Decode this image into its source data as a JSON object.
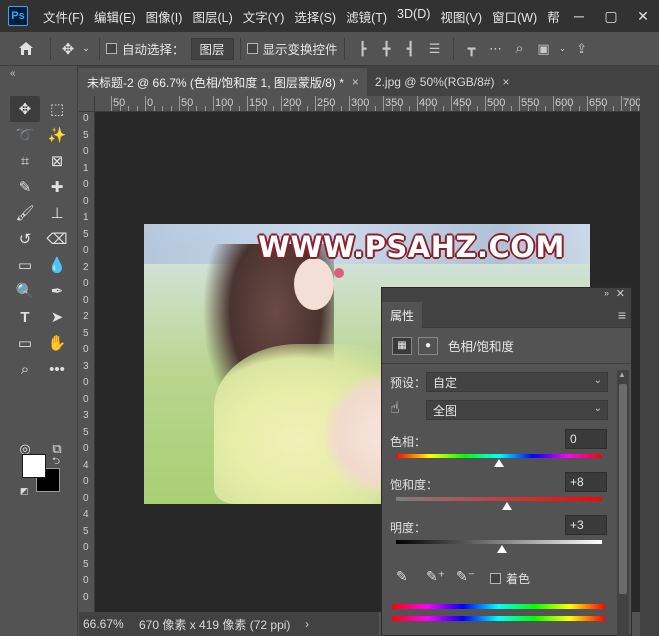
{
  "app": {
    "logo": "Ps"
  },
  "menus": [
    "文件(F)",
    "编辑(E)",
    "图像(I)",
    "图层(L)",
    "文字(Y)",
    "选择(S)",
    "滤镜(T)",
    "3D(D)",
    "视图(V)",
    "窗口(W)",
    "帮"
  ],
  "window_controls": {
    "minimize": "─",
    "maximize": "▢",
    "close": "✕"
  },
  "options": {
    "auto_select_label": "自动选择：",
    "auto_select_value": "图层",
    "show_transform_label": "显示变换控件"
  },
  "tabs": [
    {
      "label": "未标题-2 @ 66.7% (色相/饱和度 1, 图层蒙版/8) *",
      "close": "×"
    },
    {
      "label": "2.jpg @ 50%(RGB/8#)",
      "close": "×"
    }
  ],
  "ruler_top": [
    "50",
    "0",
    "50",
    "100",
    "150",
    "200",
    "250",
    "300",
    "350",
    "400",
    "450",
    "500",
    "550",
    "600",
    "650",
    "700"
  ],
  "ruler_left": [
    "0",
    "5",
    "0",
    "1",
    "0",
    "0",
    "1",
    "5",
    "0",
    "2",
    "0",
    "0",
    "2",
    "5",
    "0",
    "3",
    "0",
    "0",
    "3",
    "5",
    "0",
    "4",
    "0",
    "0",
    "4",
    "5",
    "0",
    "5",
    "0",
    "0"
  ],
  "image": {
    "watermark": "WWW.PSAHZ.COM"
  },
  "status": {
    "zoom": "66.67%",
    "doc_info": "670 像素 x 419 像素 (72 ppi)",
    "arrow": "›"
  },
  "properties": {
    "tab_label": "属性",
    "title": "色相/饱和度",
    "preset_label": "预设：",
    "preset_value": "自定",
    "channel_value": "全图",
    "hue_label": "色相：",
    "hue_value": "0",
    "hue_level": 0,
    "saturation_label": "饱和度：",
    "saturation_value": "+8",
    "saturation_level": 8,
    "lightness_label": "明度：",
    "lightness_value": "+3",
    "lightness_level": 3,
    "colorize_label": "着色"
  },
  "colors": {
    "fg": "#ffffff",
    "bg": "#000000",
    "accent": "#31a8ff"
  }
}
